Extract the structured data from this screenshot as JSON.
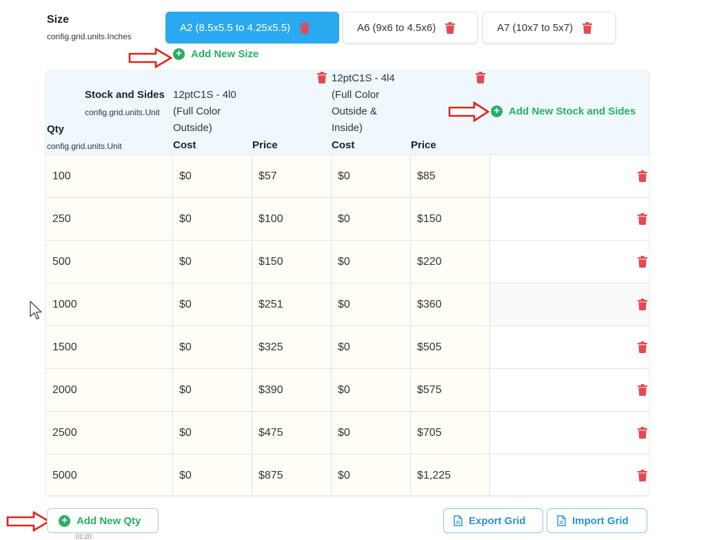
{
  "size": {
    "label": "Size",
    "unit": "config.grid.units.Inches",
    "tabs": [
      {
        "label": "A2 (8.5x5.5 to 4.25x5.5)",
        "active": true
      },
      {
        "label": "A6 (9x6 to 4.5x6)",
        "active": false
      },
      {
        "label": "A7 (10x7 to 5x7)",
        "active": false
      }
    ],
    "add_label": "Add New Size"
  },
  "grid": {
    "stock_label": "Stock and Sides",
    "stock_unit": "config.grid.units.Unit",
    "qty_label": "Qty",
    "qty_unit": "config.grid.units.Unit",
    "stocks": [
      {
        "line1": "12ptC1S - 4l0",
        "line2": "(Full Color",
        "line3": "Outside)",
        "line4": ""
      },
      {
        "line1": "12ptC1S - 4l4",
        "line2": "(Full Color",
        "line3": "Outside &",
        "line4": "Inside)"
      }
    ],
    "cost_label": "Cost",
    "price_label": "Price",
    "add_stock_label": "Add New Stock and Sides",
    "rows": [
      {
        "qty": "100",
        "c1": "$0",
        "p1": "$57",
        "c2": "$0",
        "p2": "$85"
      },
      {
        "qty": "250",
        "c1": "$0",
        "p1": "$100",
        "c2": "$0",
        "p2": "$150"
      },
      {
        "qty": "500",
        "c1": "$0",
        "p1": "$150",
        "c2": "$0",
        "p2": "$220"
      },
      {
        "qty": "1000",
        "c1": "$0",
        "p1": "$251",
        "c2": "$0",
        "p2": "$360"
      },
      {
        "qty": "1500",
        "c1": "$0",
        "p1": "$325",
        "c2": "$0",
        "p2": "$505"
      },
      {
        "qty": "2000",
        "c1": "$0",
        "p1": "$390",
        "c2": "$0",
        "p2": "$575"
      },
      {
        "qty": "2500",
        "c1": "$0",
        "p1": "$475",
        "c2": "$0",
        "p2": "$705"
      },
      {
        "qty": "5000",
        "c1": "$0",
        "p1": "$875",
        "c2": "$0",
        "p2": "$1,225"
      }
    ]
  },
  "footer": {
    "add_qty_label": "Add New Qty",
    "export_label": "Export Grid",
    "import_label": "Import Grid",
    "timestamp": "01:20"
  },
  "colors": {
    "accent_blue": "#2aa8f0",
    "add_green": "#27b064",
    "trash_red": "#e8484f",
    "arrow_red": "#e0201c",
    "header_bg": "#eef8fd"
  },
  "icons": {
    "trash": "trash-icon",
    "plus": "plus-circle-icon",
    "doc": "document-icon",
    "arrow": "right-arrow-annotation",
    "cursor": "mouse-cursor-icon"
  }
}
